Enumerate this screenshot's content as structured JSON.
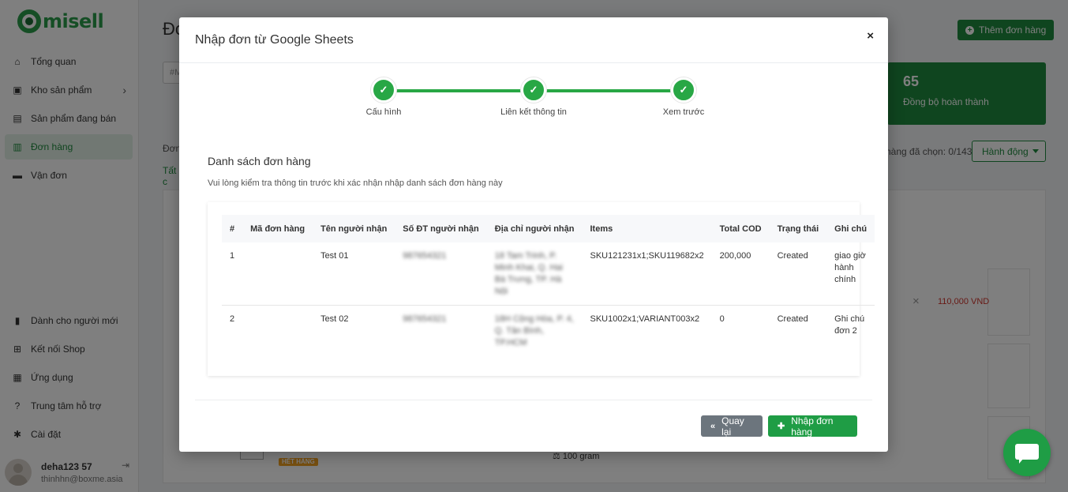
{
  "sidebar": {
    "logo_text": "misell",
    "nav_top": [
      {
        "label": "Tổng quan",
        "icon": "home-icon",
        "glyph": "⌂"
      },
      {
        "label": "Kho sản phẩm",
        "icon": "box-icon",
        "glyph": "▣"
      },
      {
        "label": "Sản phẩm đang bán",
        "icon": "store-icon",
        "glyph": "▤"
      },
      {
        "label": "Đơn hàng",
        "icon": "orders-icon",
        "glyph": "▥"
      },
      {
        "label": "Vận đơn",
        "icon": "truck-icon",
        "glyph": "▬"
      }
    ],
    "nav_bottom": [
      {
        "label": "Dành cho người mới",
        "icon": "book-icon",
        "glyph": "▮"
      },
      {
        "label": "Kết nối Shop",
        "icon": "cart-icon",
        "glyph": "⊞"
      },
      {
        "label": "Ứng dụng",
        "icon": "apps-icon",
        "glyph": "▦"
      },
      {
        "label": "Trung tâm hỗ trợ",
        "icon": "help-icon",
        "glyph": "?"
      },
      {
        "label": "Cài đặt",
        "icon": "gear-icon",
        "glyph": "✱"
      }
    ],
    "user_name": "deha123 57",
    "user_email": "thinhhn@boxme.asia"
  },
  "background": {
    "page_title": "Đơ",
    "add_order_label": "Thêm đơn hàng",
    "search_placeholder": "#M",
    "stat_number": "65",
    "stat_label": "Đồng bộ hoàn thành",
    "selected_count": "hàng đã chọn: 0/143",
    "action_label": "Hành động",
    "filter_label": "Đơn",
    "tab_all": "Tất c",
    "price": "110,000 VND",
    "out_of_stock_badge": "HẾT HÀNG",
    "weight": "100 gram"
  },
  "modal": {
    "title": "Nhập đơn từ Google Sheets",
    "close_glyph": "×",
    "steps": [
      {
        "label": "Cấu hình"
      },
      {
        "label": "Liên kết thông tin"
      },
      {
        "label": "Xem trước"
      }
    ],
    "section_title": "Danh sách đơn hàng",
    "section_subtitle": "Vui lòng kiểm tra thông tin trước khi xác nhận nhập danh sách đơn hàng này",
    "table": {
      "headers": [
        "#",
        "Mã đơn hàng",
        "Tên người nhận",
        "Số ĐT người nhận",
        "Địa chỉ người nhận",
        "Items",
        "Total COD",
        "Trạng thái",
        "Ghi chú"
      ],
      "rows": [
        {
          "no": "1",
          "order_code": "",
          "recipient": "Test 01",
          "phone": "987654321",
          "address": "18 Tam Trinh, P. Minh Khai, Q. Hai Bà Trưng, TP. Hà Nội",
          "items": "SKU121231x1;SKU119682x2",
          "cod": "200,000",
          "status": "Created",
          "note": "giao giờ hành chính"
        },
        {
          "no": "2",
          "order_code": "",
          "recipient": "Test 02",
          "phone": "987654321",
          "address": "18H Cộng Hòa, P. 4, Q. Tân Bình, TP.HCM",
          "items": "SKU1002x1;VARIANT003x2",
          "cod": "0",
          "status": "Created",
          "note": "Ghi chú đơn 2"
        }
      ]
    },
    "back_label": "Quay lại",
    "import_label": "Nhập đơn hàng"
  }
}
